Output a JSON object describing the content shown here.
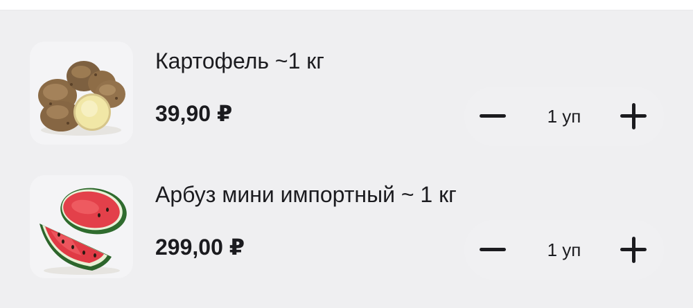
{
  "cart": {
    "items": [
      {
        "name": "Картофель ~1 кг",
        "price": "39,90 ₽",
        "quantity": "1 уп",
        "image_icon": "potato-image"
      },
      {
        "name": "Арбуз мини импортный ~ 1 кг",
        "price": "299,00 ₽",
        "quantity": "1 уп",
        "image_icon": "watermelon-image"
      }
    ]
  },
  "icons": {
    "decrease": "minus-icon",
    "increase": "plus-icon"
  },
  "colors": {
    "text": "#1b1b1f",
    "stepper_bg": "#f0f0f2",
    "thumb_bg": "#f4f4f6",
    "page_bg": "#efeff1"
  }
}
